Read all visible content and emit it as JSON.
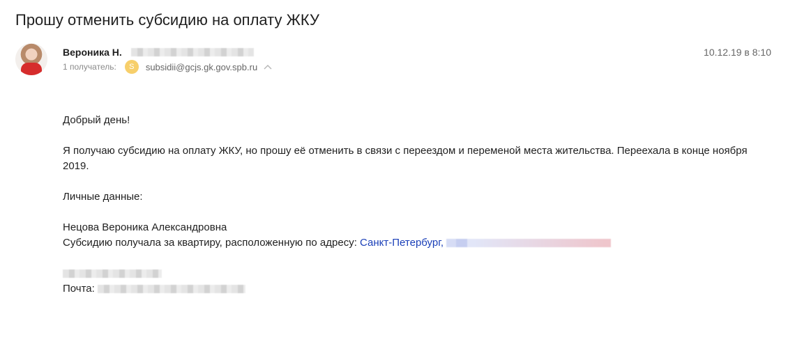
{
  "email": {
    "subject": "Прошу отменить субсидию на оплату ЖКУ",
    "sender_name": "Вероника Н.",
    "date": "10.12.19 в 8:10",
    "recipients_label": "1 получатель:",
    "recipient_initial": "S",
    "recipient_email": "subsidii@gcjs.gk.gov.spb.ru"
  },
  "body": {
    "greeting": "Добрый день!",
    "para1": "Я получаю субсидию на оплату ЖКУ, но прошу её отменить в связи с переездом и переменой места жительства. Переехала в конце ноября 2019.",
    "personal_label": "Личные данные:",
    "full_name": "Нецова Вероника Александровна",
    "address_prefix": "Субсидию получала за квартиру, расположенную по адресу: ",
    "address_city": "Санкт-Петербург,",
    "mail_label": "Почта: "
  },
  "colors": {
    "link": "#1a3fb8",
    "recipient_avatar": "#f7cf6b"
  }
}
